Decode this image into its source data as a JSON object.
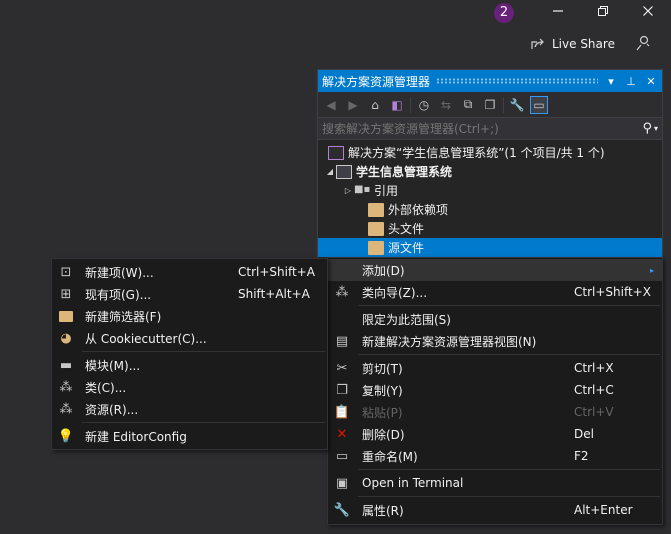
{
  "titlebar": {
    "notification_count": "2",
    "minimize_icon": "minimize-icon",
    "restore_icon": "restore-icon",
    "close_icon": "close-icon",
    "live_share_label": "Live Share"
  },
  "solution_explorer": {
    "title": "解决方案资源管理器",
    "search_placeholder": "搜索解决方案资源管理器(Ctrl+;)",
    "tree": [
      {
        "label": "解决方案“学生信息管理系统”(1 个项目/共 1 个)",
        "icon": "solution-icon"
      },
      {
        "label": "学生信息管理系统",
        "icon": "project-icon",
        "bold": true
      },
      {
        "label": "引用",
        "icon": "references-icon"
      },
      {
        "label": "外部依赖项",
        "icon": "folder-icon"
      },
      {
        "label": "头文件",
        "icon": "folder-icon"
      },
      {
        "label": "源文件",
        "icon": "folder-icon",
        "selected": true
      }
    ]
  },
  "context_menu": {
    "items": [
      {
        "label": "添加(D)",
        "shortcut": "",
        "icon": "",
        "submenu": true
      },
      {
        "label": "类向导(Z)...",
        "shortcut": "Ctrl+Shift+X",
        "icon": "class-wizard-icon"
      },
      {
        "label": "限定为此范围(S)",
        "shortcut": "",
        "icon": ""
      },
      {
        "label": "新建解决方案资源管理器视图(N)",
        "shortcut": "",
        "icon": "new-view-icon"
      },
      {
        "label": "剪切(T)",
        "shortcut": "Ctrl+X",
        "icon": "cut-icon"
      },
      {
        "label": "复制(Y)",
        "shortcut": "Ctrl+C",
        "icon": "copy-icon"
      },
      {
        "label": "粘贴(P)",
        "shortcut": "Ctrl+V",
        "icon": "paste-icon",
        "disabled": true
      },
      {
        "label": "删除(D)",
        "shortcut": "Del",
        "icon": "delete-icon"
      },
      {
        "label": "重命名(M)",
        "shortcut": "F2",
        "icon": "rename-icon"
      },
      {
        "label": "Open in Terminal",
        "shortcut": "",
        "icon": "terminal-icon"
      },
      {
        "label": "属性(R)",
        "shortcut": "Alt+Enter",
        "icon": "properties-icon"
      }
    ]
  },
  "add_submenu": {
    "items": [
      {
        "label": "新建项(W)...",
        "shortcut": "Ctrl+Shift+A",
        "icon": "new-item-icon"
      },
      {
        "label": "现有项(G)...",
        "shortcut": "Shift+Alt+A",
        "icon": "existing-item-icon"
      },
      {
        "label": "新建筛选器(F)",
        "shortcut": "",
        "icon": "new-filter-icon"
      },
      {
        "label": "从 Cookiecutter(C)...",
        "shortcut": "",
        "icon": "cookiecutter-icon"
      },
      {
        "label": "模块(M)...",
        "shortcut": "",
        "icon": "module-icon"
      },
      {
        "label": "类(C)...",
        "shortcut": "",
        "icon": "class-icon"
      },
      {
        "label": "资源(R)...",
        "shortcut": "",
        "icon": "resource-icon"
      },
      {
        "label": "新建 EditorConfig",
        "shortcut": "",
        "icon": "editorconfig-icon"
      }
    ]
  },
  "colors": {
    "accent": "#007acc",
    "badge": "#68217a",
    "background": "#2d2d30",
    "menu_bg": "#1b1b1c",
    "delete_red": "#e51400"
  }
}
